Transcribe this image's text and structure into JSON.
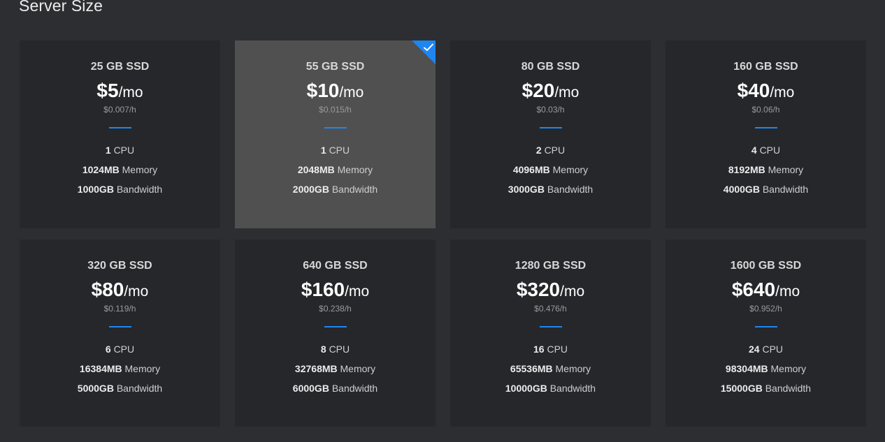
{
  "section": {
    "title": "Server Size"
  },
  "labels": {
    "cpu": "CPU",
    "memory": "Memory",
    "bandwidth": "Bandwidth",
    "per_month": "/mo"
  },
  "colors": {
    "accent": "#1f86f0",
    "selected_bg": "#505051",
    "card_bg": "#26272b",
    "page_bg": "#2d2e32"
  },
  "plans": [
    {
      "disk": "25 GB SSD",
      "price": "$5",
      "hourly": "$0.007/h",
      "cpu": "1",
      "memory": "1024MB",
      "bandwidth": "1000GB",
      "selected": false
    },
    {
      "disk": "55 GB SSD",
      "price": "$10",
      "hourly": "$0.015/h",
      "cpu": "1",
      "memory": "2048MB",
      "bandwidth": "2000GB",
      "selected": true,
      "selected_icon": "checkmark-icon"
    },
    {
      "disk": "80 GB SSD",
      "price": "$20",
      "hourly": "$0.03/h",
      "cpu": "2",
      "memory": "4096MB",
      "bandwidth": "3000GB",
      "selected": false
    },
    {
      "disk": "160 GB SSD",
      "price": "$40",
      "hourly": "$0.06/h",
      "cpu": "4",
      "memory": "8192MB",
      "bandwidth": "4000GB",
      "selected": false
    },
    {
      "disk": "320 GB SSD",
      "price": "$80",
      "hourly": "$0.119/h",
      "cpu": "6",
      "memory": "16384MB",
      "bandwidth": "5000GB",
      "selected": false
    },
    {
      "disk": "640 GB SSD",
      "price": "$160",
      "hourly": "$0.238/h",
      "cpu": "8",
      "memory": "32768MB",
      "bandwidth": "6000GB",
      "selected": false
    },
    {
      "disk": "1280 GB SSD",
      "price": "$320",
      "hourly": "$0.476/h",
      "cpu": "16",
      "memory": "65536MB",
      "bandwidth": "10000GB",
      "selected": false
    },
    {
      "disk": "1600 GB SSD",
      "price": "$640",
      "hourly": "$0.952/h",
      "cpu": "24",
      "memory": "98304MB",
      "bandwidth": "15000GB",
      "selected": false
    }
  ]
}
